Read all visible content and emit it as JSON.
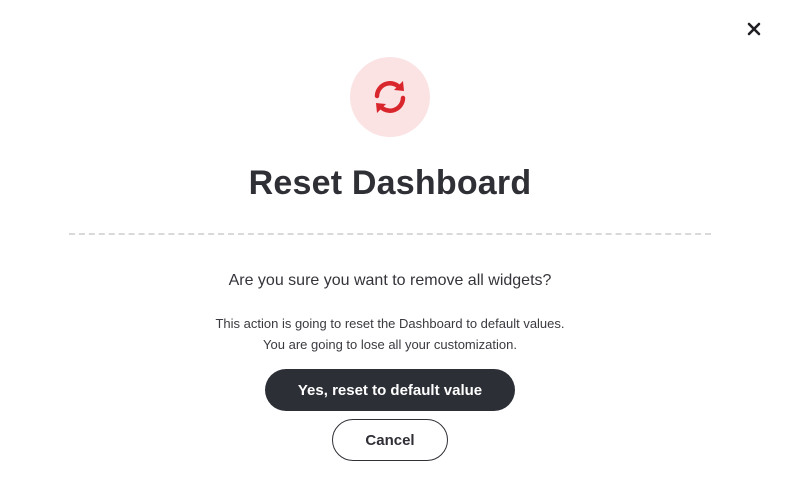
{
  "dialog": {
    "title": "Reset Dashboard",
    "question": "Are you sure you want to remove all widgets?",
    "description_line1": "This action is going to reset the Dashboard to default values.",
    "description_line2": "You are going to lose all your customization.",
    "confirm_label": "Yes, reset to default value",
    "cancel_label": "Cancel",
    "icon": "refresh-icon",
    "close_icon": "close-icon"
  },
  "colors": {
    "accent_red": "#d9262c",
    "icon_bg": "#fbe3e4",
    "primary_button": "#2c2f36",
    "text": "#2f2f36"
  }
}
